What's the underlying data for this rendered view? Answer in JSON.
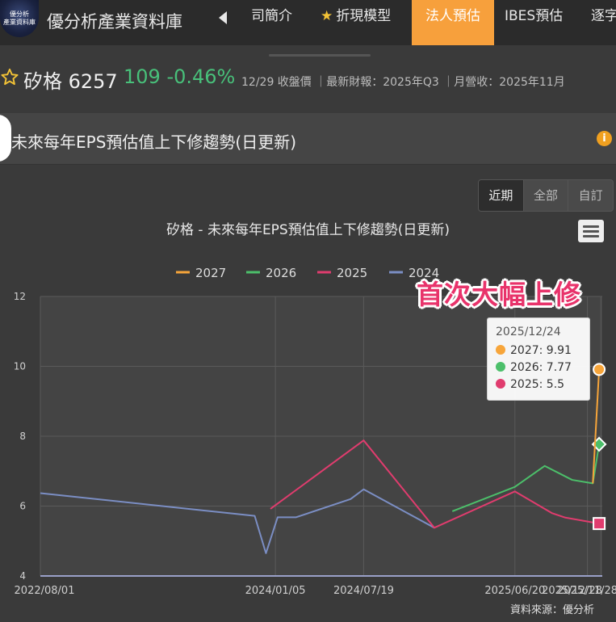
{
  "header": {
    "logo_line1": "優分析",
    "logo_line2": "產業資料庫",
    "site_title": "優分析產業資料庫",
    "tabs": [
      {
        "label": "司簡介"
      },
      {
        "label": "折現模型"
      },
      {
        "label": "法人預估"
      },
      {
        "label": "IBES預估"
      },
      {
        "label": "逐字"
      }
    ]
  },
  "stock": {
    "name": "矽格 6257",
    "price": "109",
    "change": "-0.46%",
    "meta": "12/29 收盤價 ｜最新財報：2025年Q3 ｜月營收：2025年11月"
  },
  "panel": {
    "title": "未來每年EPS預估值上下修趨勢(日更新)",
    "info_glyph": "i"
  },
  "range_buttons": [
    {
      "label": "近期"
    },
    {
      "label": "全部"
    },
    {
      "label": "自訂"
    }
  ],
  "annotation": "首次大幅上修",
  "tooltip": {
    "date": "2025/12/24",
    "rows": [
      {
        "label": "2027: 9.91",
        "color": "#f7a53a"
      },
      {
        "label": "2026: 7.77",
        "color": "#4cbf6a"
      },
      {
        "label": "2025: 5.5",
        "color": "#e03c6e"
      }
    ]
  },
  "source": "資料來源：優分析",
  "chart_data": {
    "type": "line",
    "title": "矽格 - 未來每年EPS預估值上下修趨勢(日更新)",
    "ylim": [
      4,
      12
    ],
    "yticks": [
      "4",
      "6",
      "8",
      "10",
      "12"
    ],
    "x_range": [
      "2022-08-01",
      "2025-12-31"
    ],
    "xticks": [
      "2022/08/01",
      "2024/01/05",
      "2024/07/19",
      "2025/06/20",
      "2025/11/28",
      "2025/12/28"
    ],
    "legend_position": "top-center",
    "series": [
      {
        "name": "2027",
        "color": "#f7a53a",
        "marker": "circle",
        "points": [
          [
            "2025-12-10",
            6.65
          ],
          [
            "2025-12-24",
            9.91
          ]
        ]
      },
      {
        "name": "2026",
        "color": "#4cbf6a",
        "marker": "diamond",
        "points": [
          [
            "2025-02-01",
            5.85
          ],
          [
            "2025-06-20",
            6.55
          ],
          [
            "2025-08-25",
            7.15
          ],
          [
            "2025-10-25",
            6.75
          ],
          [
            "2025-12-10",
            6.65
          ],
          [
            "2025-12-24",
            7.77
          ]
        ]
      },
      {
        "name": "2025",
        "color": "#e03c6e",
        "marker": "square",
        "points": [
          [
            "2023-12-25",
            5.92
          ],
          [
            "2024-07-19",
            7.88
          ],
          [
            "2024-12-23",
            5.38
          ],
          [
            "2025-06-20",
            6.42
          ],
          [
            "2025-09-10",
            5.8
          ],
          [
            "2025-10-10",
            5.67
          ],
          [
            "2025-12-24",
            5.5
          ]
        ]
      },
      {
        "name": "2024",
        "color": "#7b8ec4",
        "points": [
          [
            "2022-08-01",
            6.37
          ],
          [
            "2023-11-20",
            5.72
          ],
          [
            "2023-12-15",
            4.65
          ],
          [
            "2024-01-10",
            5.68
          ],
          [
            "2024-02-20",
            5.68
          ],
          [
            "2024-06-20",
            6.2
          ],
          [
            "2024-07-19",
            6.48
          ],
          [
            "2024-12-23",
            5.38
          ]
        ]
      }
    ]
  }
}
